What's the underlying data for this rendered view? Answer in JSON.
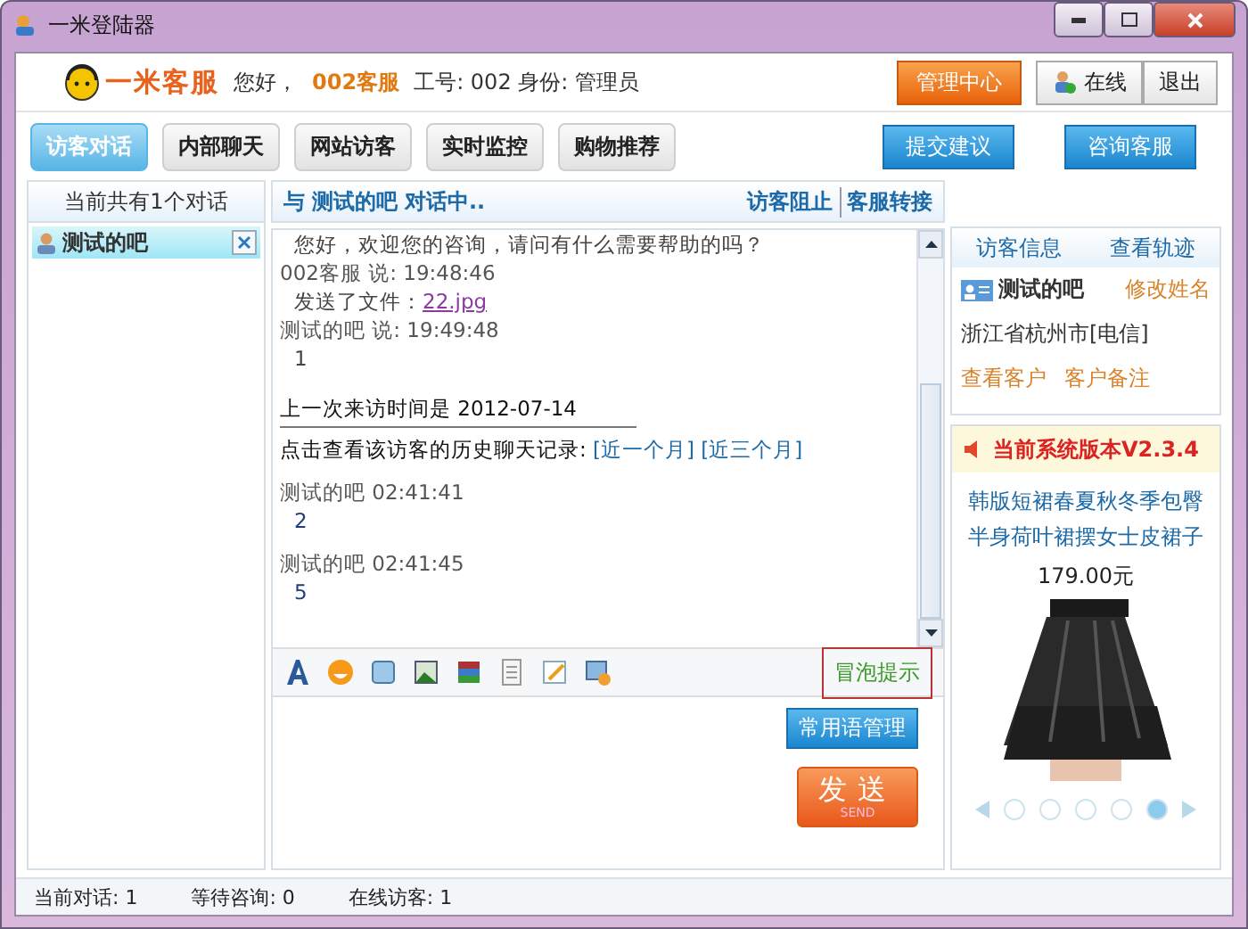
{
  "window": {
    "title": "一米登陆器"
  },
  "header": {
    "logo": "一米客服",
    "greeting": "您好，",
    "user": "002客服",
    "details": "工号: 002 身份: 管理员",
    "admin_button": "管理中心",
    "status": "在线",
    "logout": "退出"
  },
  "tabs": [
    {
      "label": "访客对话",
      "selected": true
    },
    {
      "label": "内部聊天",
      "selected": false
    },
    {
      "label": "网站访客",
      "selected": false
    },
    {
      "label": "实时监控",
      "selected": false
    },
    {
      "label": "购物推荐",
      "selected": false
    }
  ],
  "top_buttons": [
    "提交建议",
    "咨询客服"
  ],
  "sessions": {
    "title": "当前共有1个对话",
    "items": [
      {
        "name": "测试的吧",
        "selected": true
      }
    ]
  },
  "chat": {
    "prefix": "与",
    "visitor": "测试的吧",
    "suffix": "对话中..",
    "actions": [
      "访客阻止",
      "客服转接"
    ],
    "messages": [
      {
        "kind": "text",
        "text": "您好，欢迎您的咨询，请问有什么需要帮助的吗？"
      },
      {
        "kind": "meta",
        "text": "002客服  说: 19:48:46"
      },
      {
        "kind": "file",
        "text": "发送了文件：",
        "link": "22.jpg"
      },
      {
        "kind": "meta",
        "text": "测试的吧  说: 19:49:48"
      },
      {
        "kind": "text",
        "text": "1"
      },
      {
        "kind": "notice",
        "text": "上一次来访时间是  2012-07-14"
      },
      {
        "kind": "history",
        "text": "点击查看该访客的历史聊天记录:",
        "links": [
          "[近一个月]",
          "[近三个月]"
        ]
      },
      {
        "kind": "meta",
        "text": "测试的吧 02:41:41"
      },
      {
        "kind": "reply",
        "text": "2"
      },
      {
        "kind": "meta",
        "text": "测试的吧 02:41:45"
      },
      {
        "kind": "reply",
        "text": "5"
      }
    ],
    "bubble_hint": "冒泡提示",
    "phrases_button": "常用语管理",
    "send": "发送",
    "send_sub": "SEND"
  },
  "visitor_info": {
    "tabs": [
      "访客信息",
      "查看轨迹"
    ],
    "name": "测试的吧",
    "rename": "修改姓名",
    "location": "浙江省杭州市[电信]",
    "links": [
      "查看客户",
      "客户备注"
    ]
  },
  "ad": {
    "version": "当前系统版本V2.3.4",
    "product": "韩版短裙春夏秋冬季包臀半身荷叶裙摆女士皮裙子",
    "price": "179.00元",
    "slides": [
      {
        "selected": false
      },
      {
        "selected": false
      },
      {
        "selected": false
      },
      {
        "selected": false
      },
      {
        "selected": true
      }
    ]
  },
  "status_bar": [
    "当前对话: 1",
    "等待咨询: 0",
    "在线访客: 1"
  ]
}
